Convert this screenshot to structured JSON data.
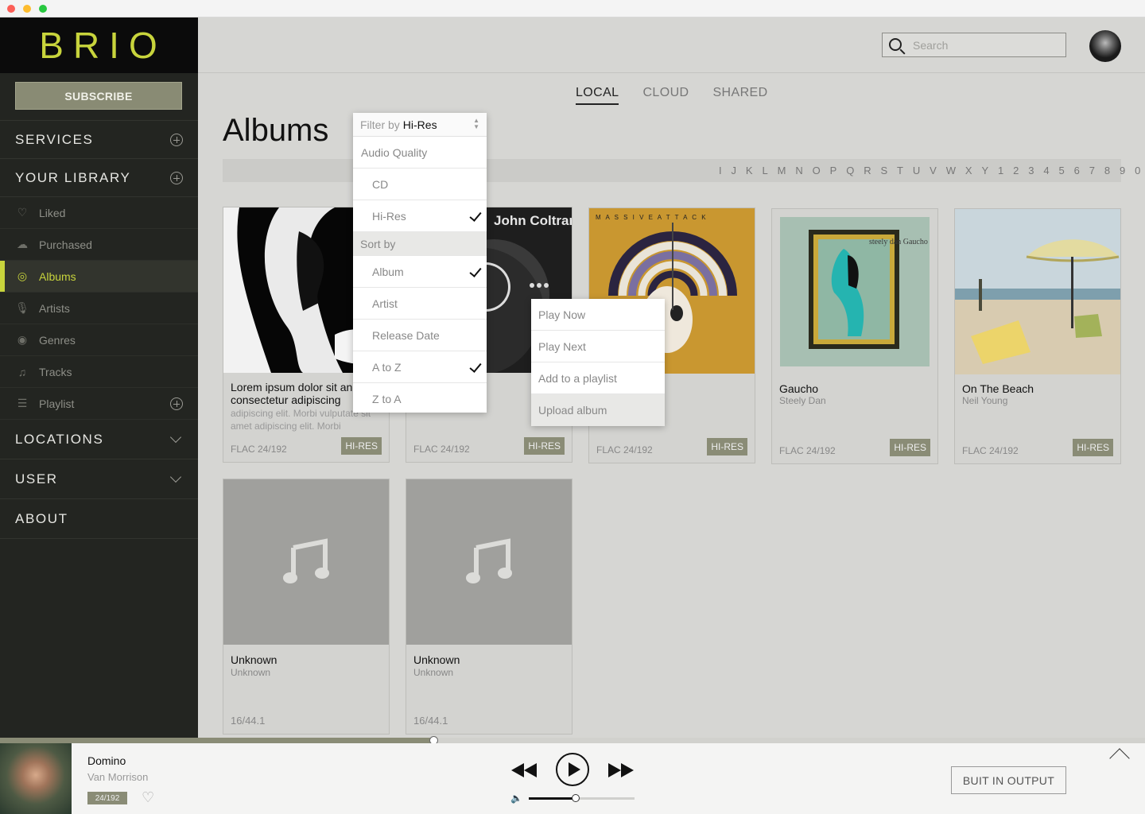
{
  "app": {
    "logo": "BRIO",
    "subscribe_label": "SUBSCRIBE",
    "accent": "#c8d43c"
  },
  "sidebar": {
    "services": "SERVICES",
    "your_library": "YOUR LIBRARY",
    "items": [
      {
        "label": "Liked",
        "icon": "heart-icon"
      },
      {
        "label": "Purchased",
        "icon": "cloud-download-icon"
      },
      {
        "label": "Albums",
        "icon": "disc-icon"
      },
      {
        "label": "Artists",
        "icon": "microphone-icon"
      },
      {
        "label": "Genres",
        "icon": "genres-icon"
      },
      {
        "label": "Tracks",
        "icon": "music-note-icon"
      },
      {
        "label": "Playlist",
        "icon": "list-icon"
      }
    ],
    "locations": "LOCATIONS",
    "user": "USER",
    "about": "ABOUT"
  },
  "header": {
    "search_placeholder": "Search"
  },
  "tabs": [
    "LOCAL",
    "CLOUD",
    "SHARED"
  ],
  "page_title": "Albums",
  "alphabet": [
    "I",
    "J",
    "K",
    "L",
    "M",
    "N",
    "O",
    "P",
    "Q",
    "R",
    "S",
    "T",
    "U",
    "V",
    "W",
    "X",
    "Y",
    "1",
    "2",
    "3",
    "4",
    "5",
    "6",
    "7",
    "8",
    "9",
    "0"
  ],
  "filter_menu": {
    "filter_by_prefix": "Filter by",
    "filter_by_value": "Hi-Res",
    "group_audio": "Audio Quality",
    "audio_options": [
      {
        "label": "CD",
        "checked": false
      },
      {
        "label": "Hi-Res",
        "checked": true
      }
    ],
    "group_sort": "Sort by",
    "sort_options": [
      {
        "label": "Album",
        "checked": true
      },
      {
        "label": "Artist",
        "checked": false
      },
      {
        "label": "Release Date",
        "checked": false
      },
      {
        "label": "A to Z",
        "checked": true
      },
      {
        "label": "Z to A",
        "checked": false
      }
    ]
  },
  "context_menu": [
    "Play Now",
    "Play Next",
    "Add to a playlist",
    "Upload album"
  ],
  "albums": [
    {
      "title": "Lorem ipsum dolor sit an consectetur adipiscing",
      "artist": "adipiscing elit. Morbi vulputate sit amet adipiscing elit. Morbi",
      "format": "FLAC 24/192",
      "badge": "HI-RES"
    },
    {
      "title": "",
      "artist": "",
      "format": "FLAC 24/192",
      "badge": "HI-RES",
      "art_text": "John Coltrane"
    },
    {
      "title": "",
      "artist": "",
      "format": "FLAC 24/192",
      "badge": "HI-RES",
      "art_text": "M A S S I V E   A T T A C K"
    },
    {
      "title": "Gaucho",
      "artist": "Steely Dan",
      "format": "FLAC 24/192",
      "badge": "HI-RES",
      "art_text": "steely dan Gaucho"
    },
    {
      "title": "On The Beach",
      "artist": "Neil Young",
      "format": "FLAC 24/192",
      "badge": "HI-RES"
    },
    {
      "title": "Unknown",
      "artist": "Unknown",
      "format": "16/44.1"
    },
    {
      "title": "Unknown",
      "artist": "Unknown",
      "format": "16/44.1"
    }
  ],
  "player": {
    "track": "Domino",
    "artist": "Van Morrison",
    "badge": "24/192",
    "output_label": "BUIT IN OUTPUT",
    "progress": 0.379,
    "volume": 0.44
  }
}
